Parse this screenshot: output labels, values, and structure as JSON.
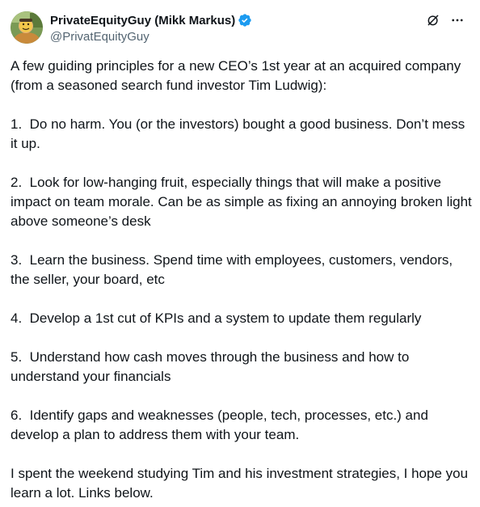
{
  "tweet": {
    "author": {
      "display_name": "PrivateEquityGuy (Mikk Markus)",
      "handle": "@PrivatEquityGuy",
      "verified": true
    },
    "icons": {
      "grok": "grok-icon",
      "more": "more-options-icon",
      "verified": "verified-badge-icon"
    },
    "paragraphs": [
      "A few guiding principles for a new CEO’s 1st year at an acquired company (from a seasoned search fund investor Tim Ludwig):",
      "1.  Do no harm. You (or the investors) bought a good business. Don’t mess it up.",
      "2.  Look for low-hanging fruit, especially things that will make a positive impact on team morale. Can be as simple as fixing an annoying broken light above someone’s desk",
      "3.  Learn the business. Spend time with employees, customers, vendors, the seller, your board, etc",
      "4.  Develop a 1st cut of KPIs and a system to update them regularly",
      "5.  Understand how cash moves through the business and how to understand your financials",
      "6.  Identify gaps and weaknesses (people, tech, processes, etc.) and develop a plan to address them with your team.",
      "I spent the weekend studying Tim and his investment strategies, I hope you learn a lot. Links below."
    ]
  },
  "colors": {
    "text_primary": "#0f1419",
    "text_secondary": "#536471",
    "verified_blue": "#1d9bf0"
  }
}
